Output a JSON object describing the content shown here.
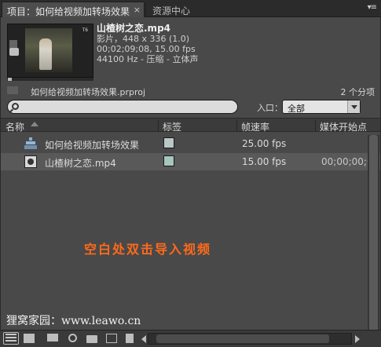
{
  "tabs": {
    "project_label": "项目：如何给视频加转场效果",
    "close_glyph": "×",
    "media_browser_label": "资源中心",
    "menu_glyph": "▾≡"
  },
  "clip_info": {
    "name": "山楂树之恋.mp4",
    "line1": "影片，448 x 336 (1.0)",
    "line2": "00;02;09;08, 15.00 fps",
    "line3": "44100 Hz - 压缩 - 立体声",
    "preview_logo": "T6"
  },
  "project": {
    "file": "如何给视频加转场效果.prproj",
    "count": "2 个分项"
  },
  "search": {
    "value": "",
    "in_label": "入口：",
    "in_value": "全部"
  },
  "columns": {
    "name": "名称",
    "label": "标签",
    "framerate": "帧速率",
    "media_start": "媒体开始点"
  },
  "rows": [
    {
      "name": "如何给视频加转场效果",
      "fps": "25.00 fps",
      "start": "",
      "swatch": "#b9c8c6",
      "kind": "sequence"
    },
    {
      "name": "山楂树之恋.mp4",
      "fps": "15.00 fps",
      "start": "00;00;00;0",
      "swatch": "#a6c6be",
      "kind": "clip"
    }
  ],
  "overlay": {
    "hint": "空白处双击导入视频",
    "credit": "狸窝家园：www.leawo.cn"
  },
  "icons": [
    "list-view-icon",
    "icon-view-icon",
    "automate-to-sequence-icon",
    "find-icon",
    "new-bin-icon",
    "new-item-icon",
    "clear-icon"
  ]
}
